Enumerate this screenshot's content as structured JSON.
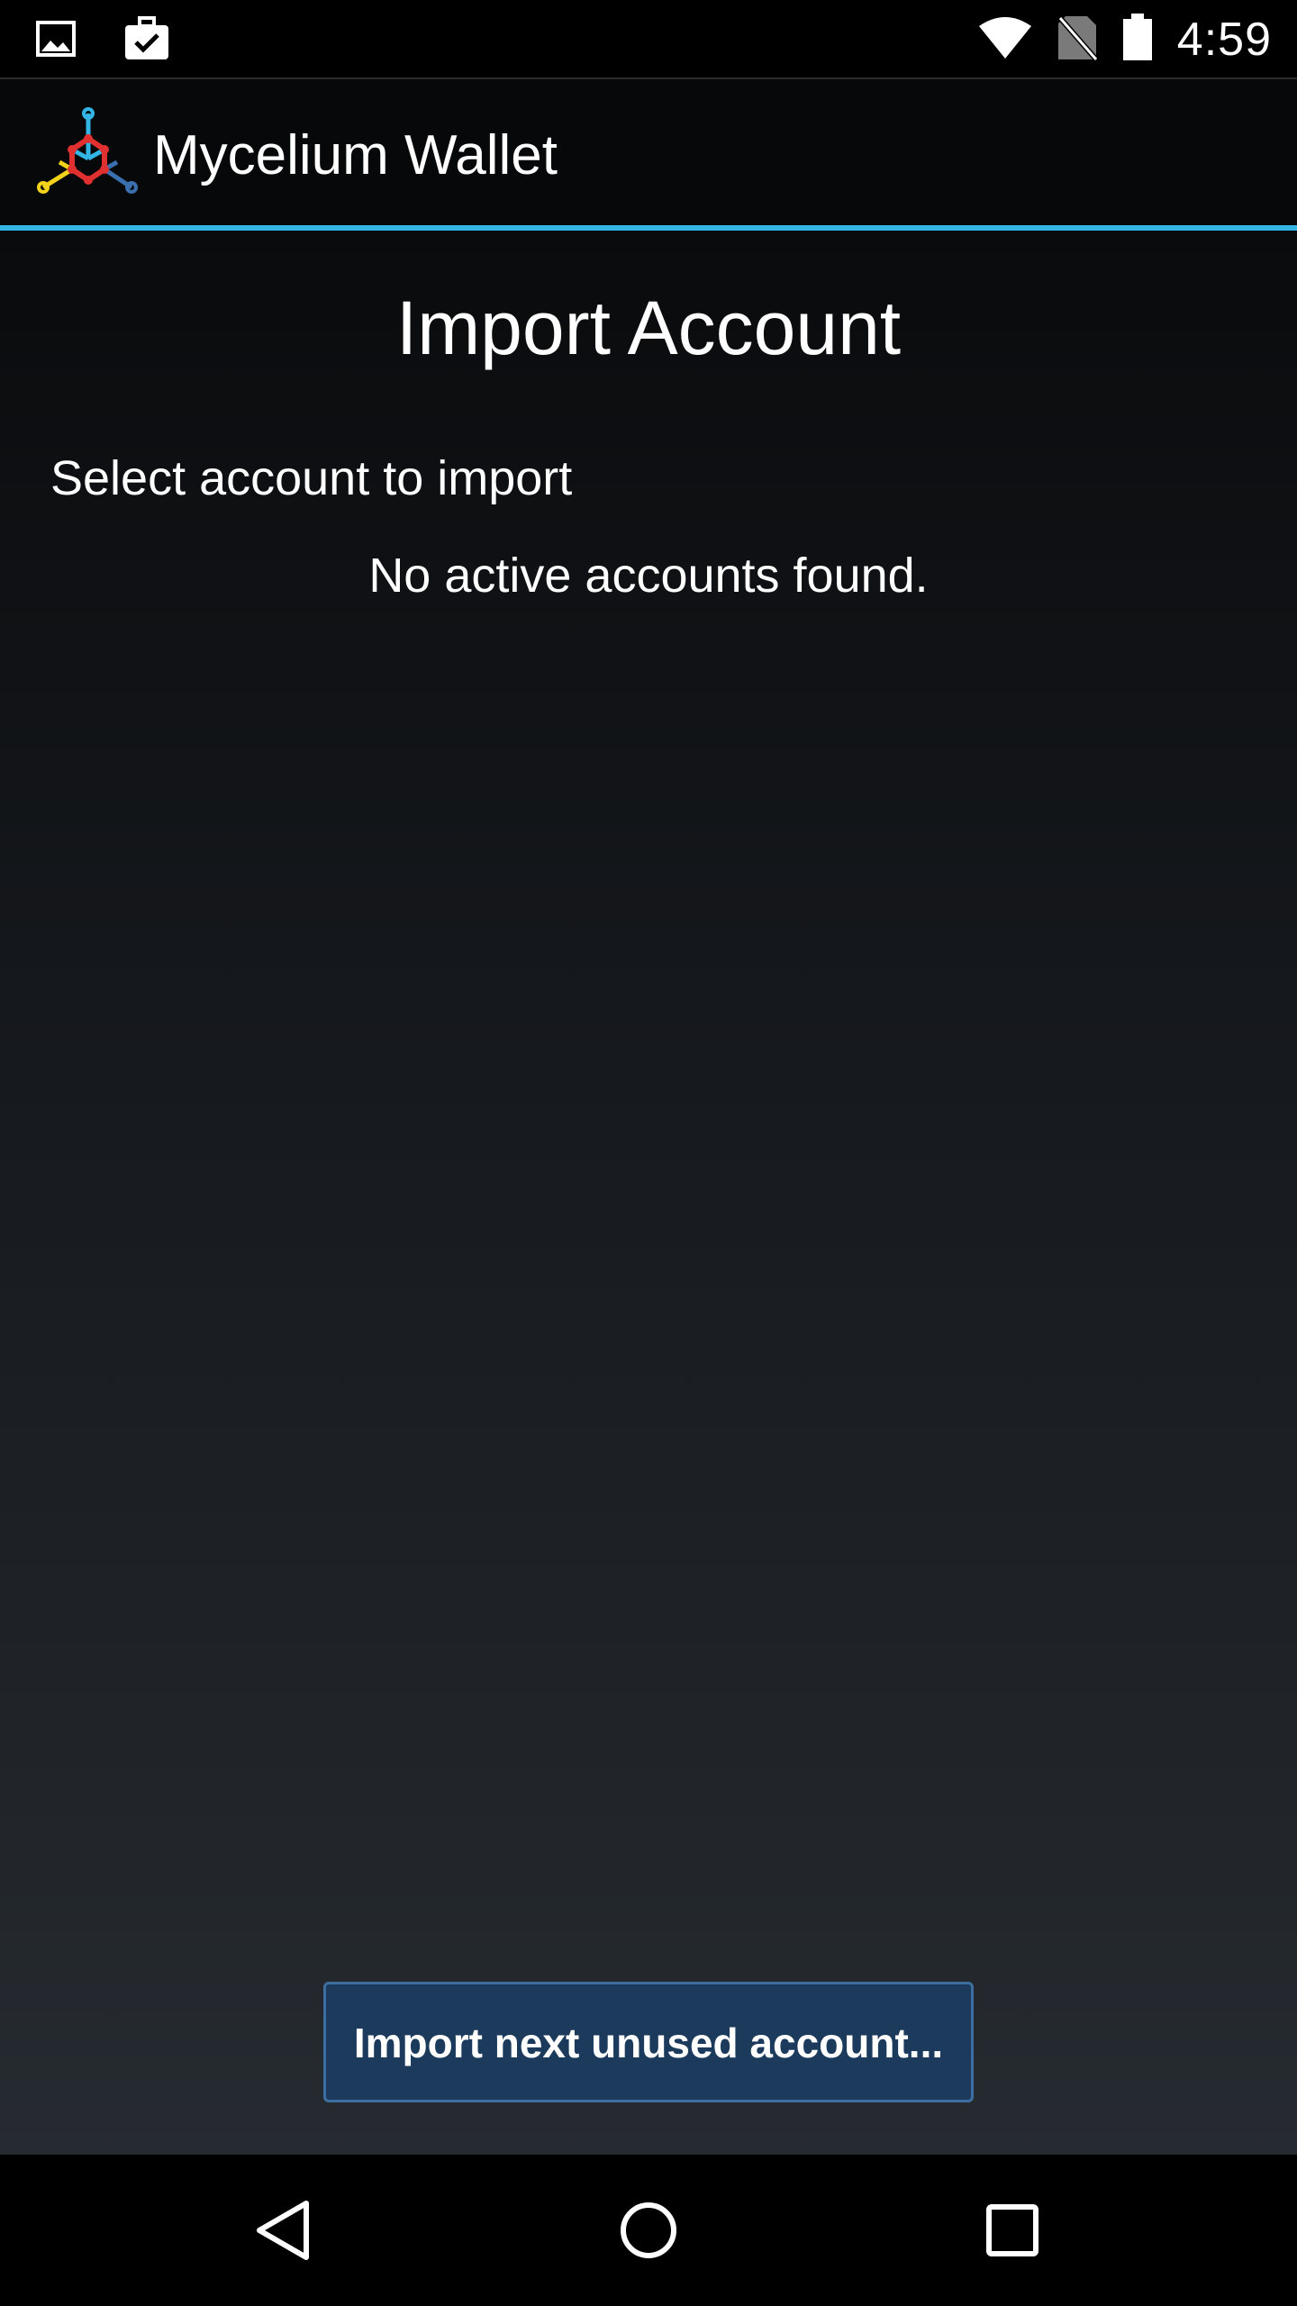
{
  "status_bar": {
    "time": "4:59",
    "icons": [
      "image-notification-icon",
      "briefcase-check-icon",
      "wifi-icon",
      "no-sim-icon",
      "battery-icon"
    ]
  },
  "action_bar": {
    "app_title": "Mycelium Wallet",
    "logo": "mycelium-logo-icon"
  },
  "main": {
    "page_title": "Import Account",
    "section_label": "Select account to import",
    "empty_message": "No active accounts found.",
    "import_button_label": "Import next unused account..."
  },
  "nav_bar": {
    "buttons": [
      "back-icon",
      "home-icon",
      "recents-icon"
    ]
  },
  "colors": {
    "accent": "#33b5e5",
    "button_bg": "#1b3a5c",
    "button_border": "#3c6e9f"
  }
}
